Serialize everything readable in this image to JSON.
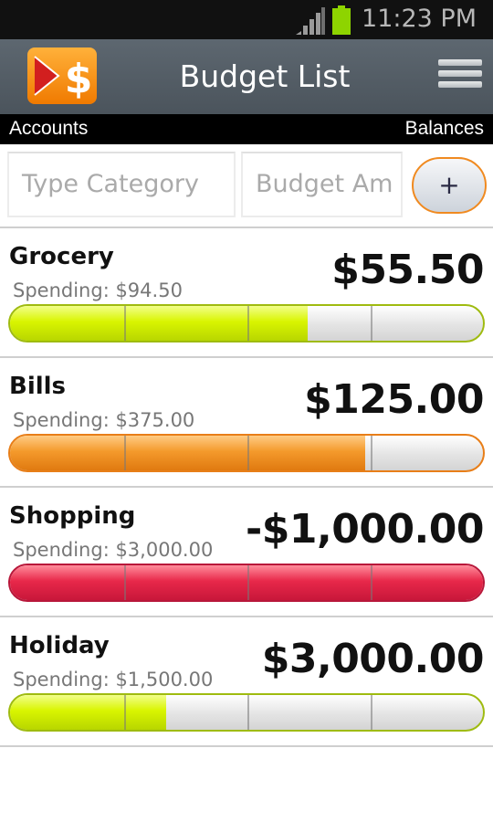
{
  "status_bar": {
    "time": "11:23 PM"
  },
  "action_bar": {
    "title": "Budget List"
  },
  "header": {
    "left": "Accounts",
    "right": "Balances"
  },
  "inputs": {
    "category_placeholder": "Type Category",
    "amount_placeholder": "Budget Am",
    "add_label": "+"
  },
  "budgets": [
    {
      "name": "Grocery",
      "spending": "Spending: $94.50",
      "balance": "$55.50",
      "fill_fraction": 0.63,
      "color": "green"
    },
    {
      "name": "Bills",
      "spending": "Spending: $375.00",
      "balance": "$125.00",
      "fill_fraction": 0.75,
      "color": "orange"
    },
    {
      "name": "Shopping",
      "spending": "Spending: $3,000.00",
      "balance": "-$1,000.00",
      "fill_fraction": 1.0,
      "color": "red"
    },
    {
      "name": "Holiday",
      "spending": "Spending: $1,500.00",
      "balance": "$3,000.00",
      "fill_fraction": 0.33,
      "color": "green"
    }
  ],
  "colors": {
    "action_bar": "#525b64",
    "accent_orange": "#f08a20",
    "bar_green": "#d9f500",
    "bar_orange": "#f49a2c",
    "bar_red": "#e8284a"
  }
}
